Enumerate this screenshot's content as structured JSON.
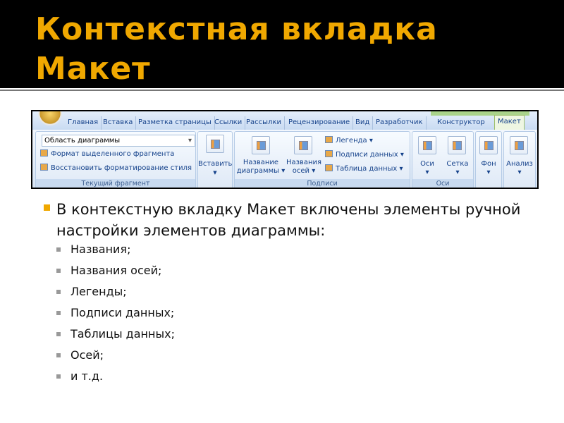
{
  "title": "Контекстная вкладка Макет",
  "ribbon": {
    "tabs": [
      "Главная",
      "Вставка",
      "Разметка страницы",
      "Ссылки",
      "Рассылки",
      "Рецензирование",
      "Вид",
      "Разработчик",
      "Конструктор",
      "Макет"
    ],
    "active_tab": "Макет",
    "current_fragment": {
      "combo_value": "Область диаграммы",
      "format_selection": "Формат выделенного фрагмента",
      "reset_style": "Восстановить форматирование стиля",
      "group_label": "Текущий фрагмент"
    },
    "insert": {
      "label": "Вставить"
    },
    "labels_group": {
      "chart_title": [
        "Название",
        "диаграммы"
      ],
      "axis_titles": [
        "Названия",
        "осей"
      ],
      "legend": "Легенда",
      "data_labels": "Подписи данных",
      "data_table": "Таблица данных",
      "group_label": "Подписи"
    },
    "axes_group": {
      "axes": "Оси",
      "gridlines": "Сетка",
      "group_label": "Оси"
    },
    "background": "Фон",
    "analysis": "Анализ"
  },
  "bullet": "В контекстную вкладку Макет включены элементы ручной настройки элементов диаграммы:",
  "sub_bullets": [
    "Названия;",
    "Названия осей;",
    "Легенды;",
    "Подписи данных;",
    "Таблицы данных;",
    "Осей;",
    "и т.д."
  ],
  "colors": {
    "title": "#f0a800",
    "header_bg": "#000000",
    "bullet_square": "#f0a800"
  }
}
